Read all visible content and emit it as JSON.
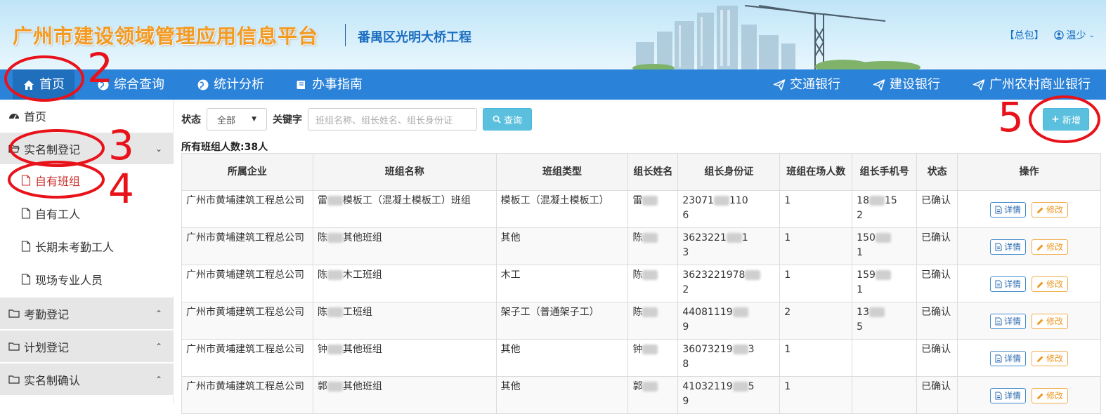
{
  "header": {
    "title": "广州市建设领域管理应用信息平台",
    "project": "番禺区光明大桥工程",
    "package_link": "【总包】",
    "user": "温少"
  },
  "nav": {
    "home": "首页",
    "query": "综合查询",
    "stats": "统计分析",
    "guide": "办事指南",
    "bank1": "交通银行",
    "bank2": "建设银行",
    "bank3": "广州农村商业银行"
  },
  "sidebar": {
    "home": "首页",
    "realname": "实名制登记",
    "own_team": "自有班组",
    "own_worker": "自有工人",
    "long_absent": "长期未考勤工人",
    "site_staff": "现场专业人员",
    "attendance": "考勤登记",
    "plan": "计划登记",
    "realname_confirm": "实名制确认"
  },
  "filter": {
    "status_label": "状态",
    "status_value": "全部",
    "keyword_label": "关键字",
    "keyword_placeholder": "班组名称、组长姓名、组长身份证",
    "query_button": "查询",
    "add_button": "新增"
  },
  "summary": "所有班组人数:38人",
  "table": {
    "headers": [
      "所属企业",
      "班组名称",
      "班组类型",
      "组长姓名",
      "组长身份证",
      "班组在场人数",
      "组长手机号",
      "状态",
      "操作"
    ],
    "detail_label": "详情",
    "edit_label": "修改",
    "rows": [
      {
        "company": "广州市黄埔建筑工程总公司",
        "team_a": "雷",
        "team_b": "模板工（混凝土模板工）班组",
        "type": "模板工（混凝土模板工）",
        "leader": "雷",
        "id_a": "23071",
        "id_b": "110",
        "id_c": "6",
        "count": "1",
        "phone_a": "18",
        "phone_b": "15",
        "phone_c": "2",
        "status": "已确认"
      },
      {
        "company": "广州市黄埔建筑工程总公司",
        "team_a": "陈",
        "team_b": "其他班组",
        "type": "其他",
        "leader": "陈",
        "id_a": "3623221",
        "id_b": "1",
        "id_c": "3",
        "count": "1",
        "phone_a": "150",
        "phone_b": "",
        "phone_c": "1",
        "status": "已确认"
      },
      {
        "company": "广州市黄埔建筑工程总公司",
        "team_a": "陈",
        "team_b": "木工班组",
        "type": "木工",
        "leader": "陈",
        "id_a": "3623221978",
        "id_b": "",
        "id_c": "2",
        "count": "1",
        "phone_a": "159",
        "phone_b": "",
        "phone_c": "1",
        "status": "已确认"
      },
      {
        "company": "广州市黄埔建筑工程总公司",
        "team_a": "陈",
        "team_b": "工班组",
        "type": "架子工（普通架子工）",
        "leader": "陈",
        "id_a": "44081119",
        "id_b": "",
        "id_c": "9",
        "count": "2",
        "phone_a": "13",
        "phone_b": "",
        "phone_c": "5",
        "status": "已确认"
      },
      {
        "company": "广州市黄埔建筑工程总公司",
        "team_a": "钟",
        "team_b": "其他班组",
        "type": "其他",
        "leader": "钟",
        "id_a": "36073219",
        "id_b": "3",
        "id_c": "8",
        "count": "1",
        "phone_a": "",
        "phone_b": "",
        "phone_c": "",
        "status": "已确认"
      },
      {
        "company": "广州市黄埔建筑工程总公司",
        "team_a": "郭",
        "team_b": "其他班组",
        "type": "其他",
        "leader": "郭",
        "id_a": "41032119",
        "id_b": "5",
        "id_c": "9",
        "count": "1",
        "phone_a": "",
        "phone_b": "",
        "phone_c": "",
        "status": "已确认"
      }
    ]
  },
  "annotations": [
    "2",
    "3",
    "4",
    "5"
  ],
  "colors": {
    "nav": "#2b82d9",
    "accent": "#5bc0de",
    "annotation": "#e8121a",
    "title": "#f39a21"
  }
}
